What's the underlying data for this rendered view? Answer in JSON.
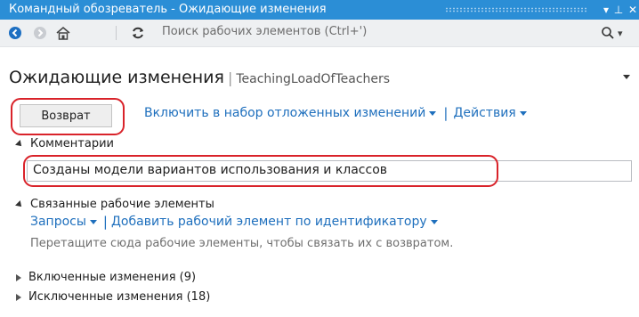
{
  "window": {
    "title": "Командный обозреватель - Ожидающие изменения",
    "pin_glyph": "▾ ⊥",
    "close_glyph": "✕"
  },
  "toolbar": {
    "search_placeholder": "Поиск рабочих элементов (Ctrl+')",
    "icons": [
      "back-icon",
      "forward-icon",
      "home-icon",
      "refresh-icon",
      "search-icon"
    ]
  },
  "header": {
    "title": "Ожидающие изменения",
    "divider": "|",
    "workspace": "TeachingLoadOfTeachers"
  },
  "actions": {
    "checkin_label": "Возврат",
    "shelve_label": "Включить в набор отложенных изменений",
    "separator": "|",
    "actions_label": "Действия"
  },
  "comments": {
    "heading": "Комментарии",
    "value": "Созданы модели вариантов использования и классов"
  },
  "related": {
    "heading": "Связанные рабочие элементы",
    "queries_label": "Запросы",
    "separator": "|",
    "add_by_id_label": "Добавить рабочий элемент по идентификатору",
    "hint": "Перетащите сюда рабочие элементы, чтобы связать их с возвратом."
  },
  "included": {
    "label": "Включенные изменения (9)"
  },
  "excluded": {
    "label": "Исключенные изменения (18)"
  },
  "colors": {
    "titlebar": "#2b8ed6",
    "link": "#1e6fbd",
    "highlight": "#d9232a"
  }
}
